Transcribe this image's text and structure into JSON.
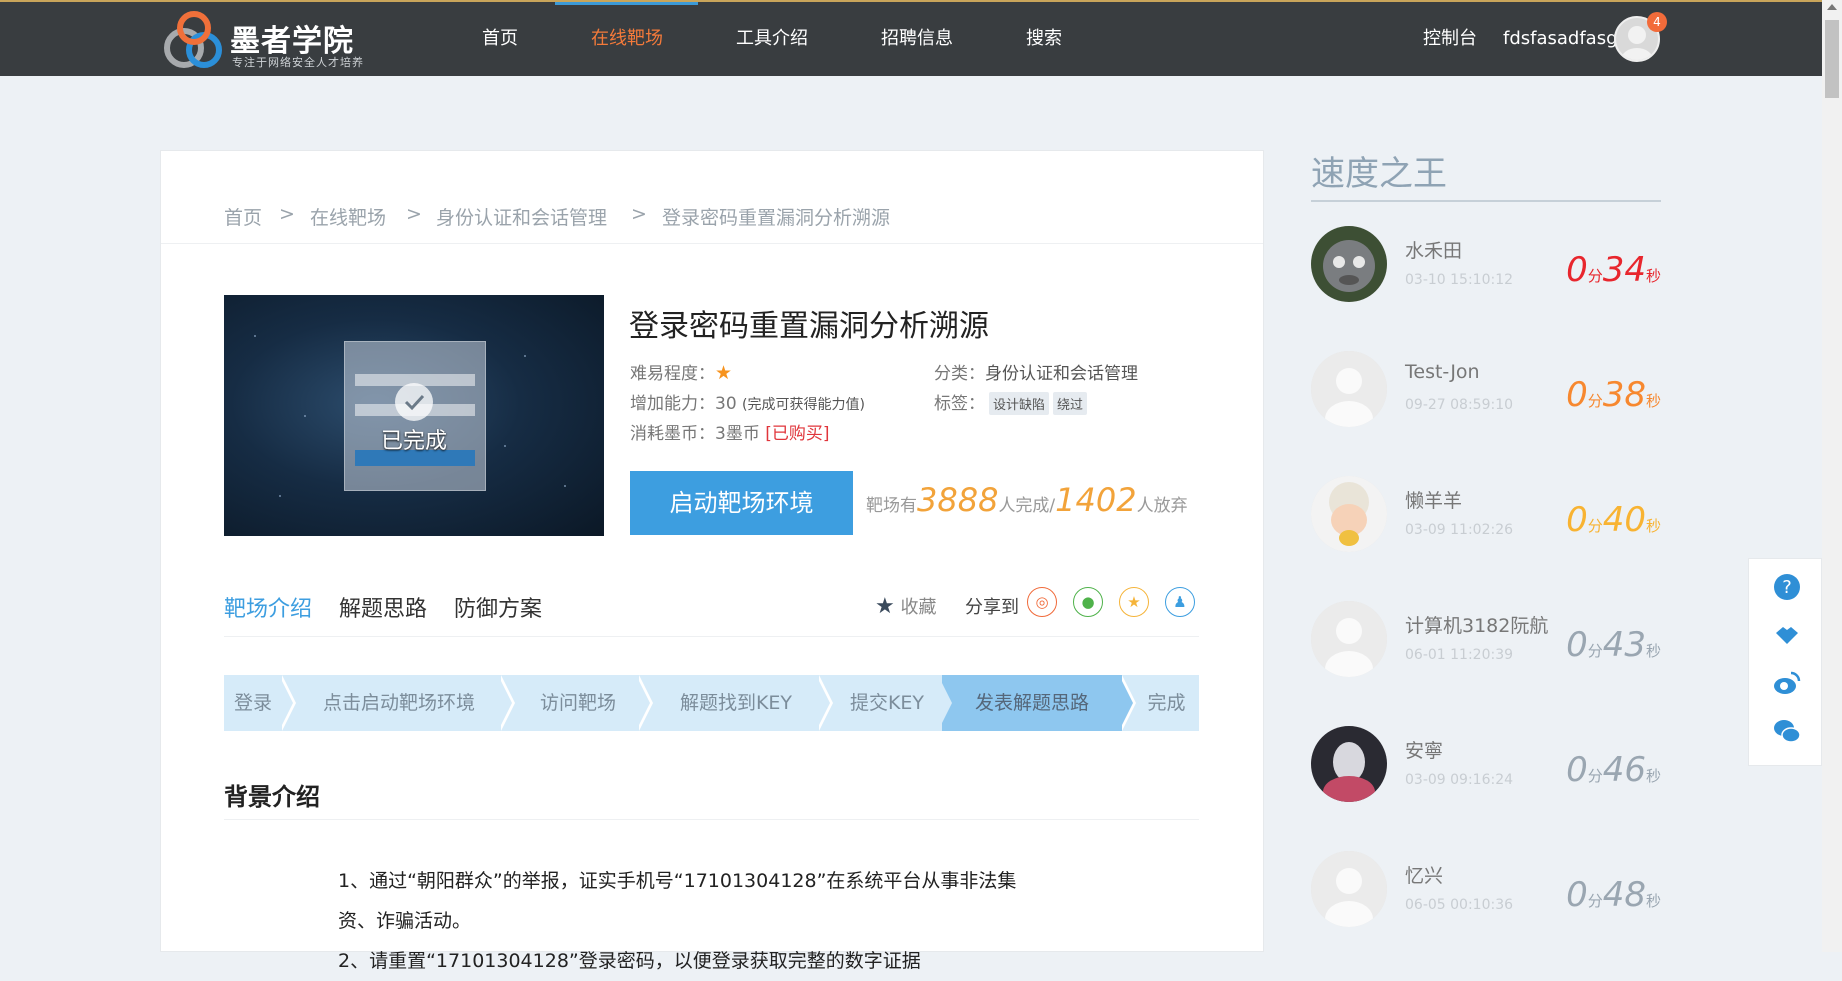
{
  "header": {
    "logo_title": "墨者学院",
    "logo_subtitle": "专注于网络安全人才培养",
    "nav": [
      "首页",
      "在线靶场",
      "工具介绍",
      "招聘信息",
      "搜索"
    ],
    "active_nav": "在线靶场",
    "console": "控制台",
    "username": "fdsfasadfasg",
    "notification_count": "4"
  },
  "breadcrumb": {
    "items": [
      "首页",
      "在线靶场",
      "身份认证和会话管理",
      "登录密码重置漏洞分析溯源"
    ],
    "separator": ">"
  },
  "challenge": {
    "thumb_status": "已完成",
    "title": "登录密码重置漏洞分析溯源",
    "difficulty_label": "难易程度：",
    "difficulty_stars": 1,
    "category_label": "分类：",
    "category": "身份认证和会话管理",
    "ability_label": "增加能力：",
    "ability_value": "30",
    "ability_note": "(完成可获得能力值)",
    "tags_label": "标签：",
    "tags": [
      "设计缺陷",
      "绕过"
    ],
    "cost_label": "消耗墨币：",
    "cost_value": "3墨币",
    "purchased": "[已购买]",
    "start_button": "启动靶场环境",
    "stats_prefix": "靶场有",
    "completed_count": "3888",
    "completed_suffix": "人完成/",
    "abandoned_count": "1402",
    "abandoned_suffix": "人放弃"
  },
  "tabs": {
    "items": [
      "靶场介绍",
      "解题思路",
      "防御方案"
    ],
    "active": "靶场介绍",
    "favorite": "收藏",
    "share_label": "分享到"
  },
  "steps": {
    "items": [
      "登录",
      "点击启动靶场环境",
      "访问靶场",
      "解题找到KEY",
      "提交KEY",
      "发表解题思路",
      "完成"
    ],
    "current": "发表解题思路"
  },
  "background": {
    "heading": "背景介绍",
    "paragraph_line1": "1、通过“朝阳群众”的举报，证实手机号“17101304128”在系统平台从事非法集",
    "paragraph_line2": "资、诈骗活动。",
    "paragraph_line3": "2、请重置“17101304128”登录密码，以便登录获取完整的数字证据"
  },
  "sidebar": {
    "title": "速度之王",
    "unit_min": "分",
    "unit_sec": "秒",
    "ranks": [
      {
        "name": "水禾田",
        "time": "03-10 15:10:12",
        "min": "0",
        "sec": "34",
        "color": "#e8262d"
      },
      {
        "name": "Test-Jon",
        "time": "09-27 08:59:10",
        "min": "0",
        "sec": "38",
        "color": "#f7882f"
      },
      {
        "name": "懒羊羊",
        "time": "03-09 11:02:26",
        "min": "0",
        "sec": "40",
        "color": "#f8b332"
      },
      {
        "name": "计算机3182阮航",
        "time": "06-01 11:20:39",
        "min": "0",
        "sec": "43",
        "color": "#9aa6b1"
      },
      {
        "name": "安寧",
        "time": "03-09 09:16:24",
        "min": "0",
        "sec": "46",
        "color": "#9aa6b1"
      },
      {
        "name": "忆兴",
        "time": "06-05 00:10:36",
        "min": "0",
        "sec": "48",
        "color": "#9aa6b1"
      }
    ]
  },
  "colors": {
    "accent": "#3d9ee0",
    "nav_active": "#f47a3a",
    "header_bg": "#393d40",
    "stat_orange": "#f2a33a",
    "red": "#e0353b"
  },
  "icons": {
    "float": [
      "help-icon",
      "handshake-icon",
      "weibo-icon",
      "wechat-icon"
    ],
    "share": [
      "weibo-icon",
      "wechat-icon",
      "qzone-icon",
      "qq-icon"
    ]
  }
}
